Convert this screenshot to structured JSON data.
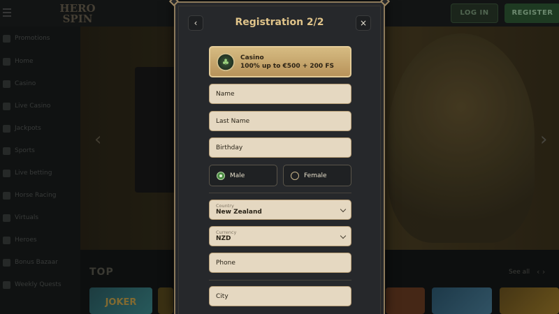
{
  "background": {
    "login_label": "LOG IN",
    "register_label": "REGISTER",
    "logo_line1": "HERO",
    "logo_line2": "SPIN",
    "sidebar_items": [
      "Promotions",
      "Home",
      "Casino",
      "Live Casino",
      "Jackpots",
      "Sports",
      "Live betting",
      "Horse Racing",
      "Virtuals",
      "Heroes",
      "Bonus Bazaar",
      "Weekly Quests"
    ],
    "section_title": "TOP",
    "see_all": "See all",
    "thumb_text": "JOKER"
  },
  "modal": {
    "title": "Registration 2/2",
    "back_icon": "‹",
    "close_icon": "×",
    "bonus": {
      "line1": "Casino",
      "line2": "100% up to €500 + 200 FS"
    },
    "fields": {
      "name": "Name",
      "last_name": "Last Name",
      "birthday": "Birthday",
      "phone": "Phone",
      "city": "City"
    },
    "gender": {
      "male": "Male",
      "female": "Female",
      "selected": "Male"
    },
    "country": {
      "label": "Country",
      "value": "New Zealand"
    },
    "currency": {
      "label": "Currency",
      "value": "NZD"
    }
  },
  "colors": {
    "accent_gold": "#e0c48a",
    "field_bg": "#e5d8c1",
    "modal_bg": "#26282b",
    "selected_green": "#4c8d44"
  }
}
